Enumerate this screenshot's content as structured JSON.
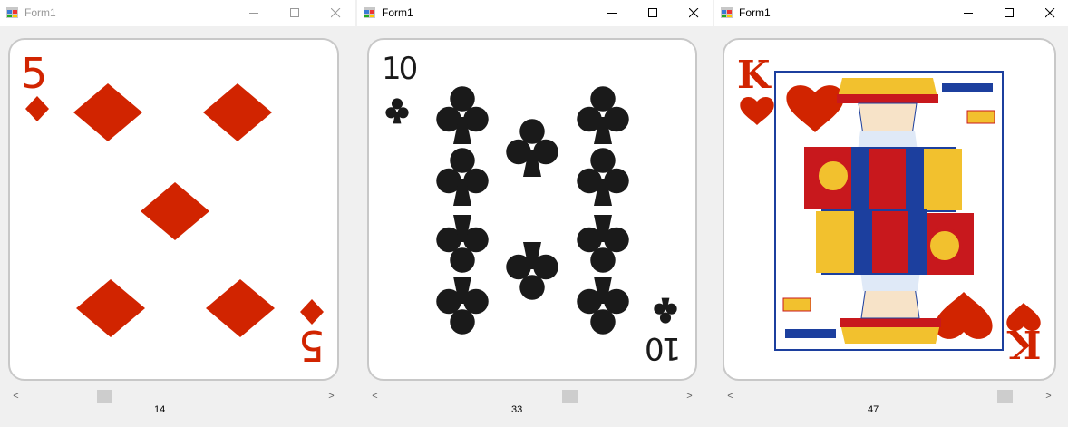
{
  "windows": [
    {
      "title": "Form1",
      "active": false,
      "card": {
        "rank": "5",
        "suit": "diamonds",
        "color": "#d12400"
      },
      "scroll_value": "14",
      "scroll_fraction": 0.29
    },
    {
      "title": "Form1",
      "active": true,
      "card": {
        "rank": "10",
        "suit": "clubs",
        "color": "#1a1a1a"
      },
      "scroll_value": "33",
      "scroll_fraction": 0.64
    },
    {
      "title": "Form1",
      "active": true,
      "card": {
        "rank": "K",
        "suit": "hearts",
        "color": "#d12400"
      },
      "scroll_value": "47",
      "scroll_fraction": 0.93
    }
  ],
  "controls": {
    "minimize": "minimize-icon",
    "maximize": "maximize-icon",
    "close": "close-icon"
  },
  "scroll": {
    "left": "<",
    "right": ">"
  }
}
